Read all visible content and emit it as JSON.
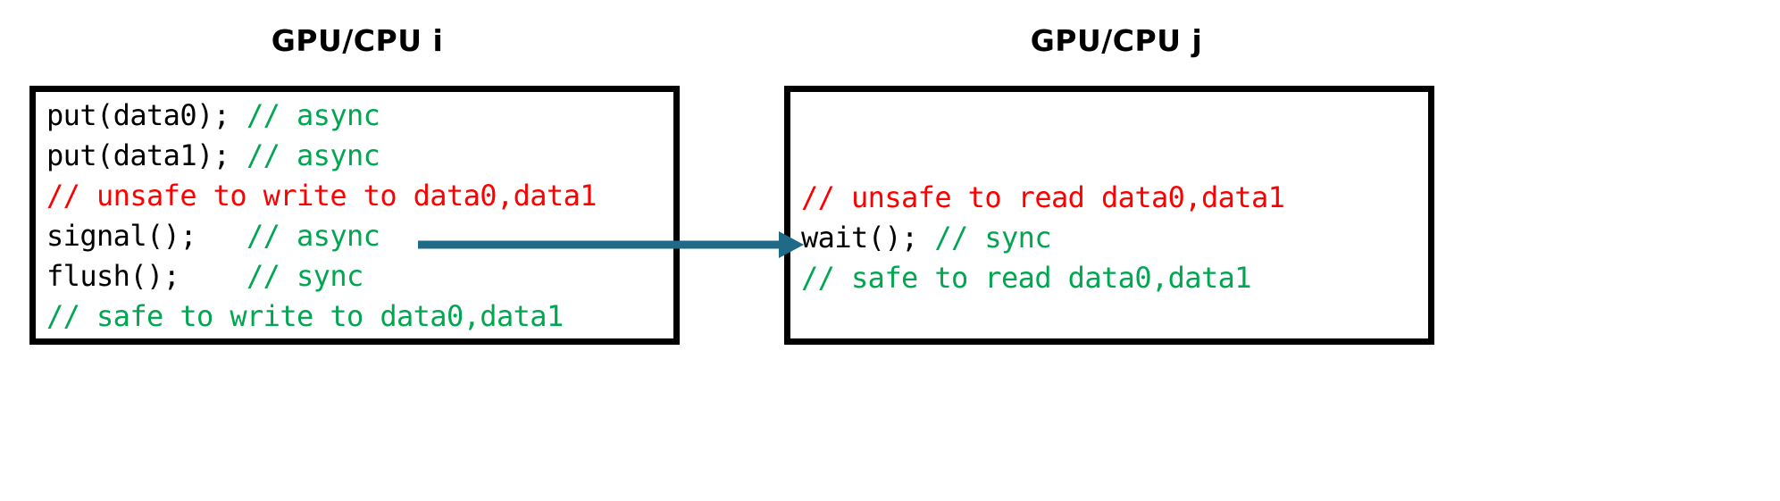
{
  "diagram": {
    "title_left": "GPU/CPU i",
    "title_right": "GPU/CPU j",
    "arrow": {
      "label": "signal-to-wait-arrow",
      "color": "#1F6A86",
      "from": "signal(); // async",
      "to": "wait(); // sync"
    },
    "colors": {
      "code": "#000000",
      "comment_safe": "#00A650",
      "comment_unsafe": "#FF0000",
      "border": "#000000",
      "arrow": "#1F6A86",
      "background": "#FFFFFF"
    },
    "left_box": {
      "name": "code-block-i",
      "lines": [
        {
          "code": "put(data0); ",
          "comment": "// async",
          "kind": "code-with-comment"
        },
        {
          "code": "put(data1); ",
          "comment": "// async",
          "kind": "code-with-comment"
        },
        {
          "code": "",
          "comment": "// unsafe to write to data0,data1",
          "kind": "unsafe"
        },
        {
          "code": "signal();   ",
          "comment": "// async",
          "kind": "code-with-comment"
        },
        {
          "code": "flush();    ",
          "comment": "// sync",
          "kind": "code-with-comment"
        },
        {
          "code": "",
          "comment": "// safe to write to data0,data1",
          "kind": "safe"
        }
      ]
    },
    "right_box": {
      "name": "code-block-j",
      "lines": [
        {
          "code": "",
          "comment": "// unsafe to read data0,data1",
          "kind": "unsafe"
        },
        {
          "code": "wait(); ",
          "comment": "// sync",
          "kind": "code-with-comment"
        },
        {
          "code": "",
          "comment": "// safe to read data0,data1",
          "kind": "safe"
        }
      ]
    }
  }
}
